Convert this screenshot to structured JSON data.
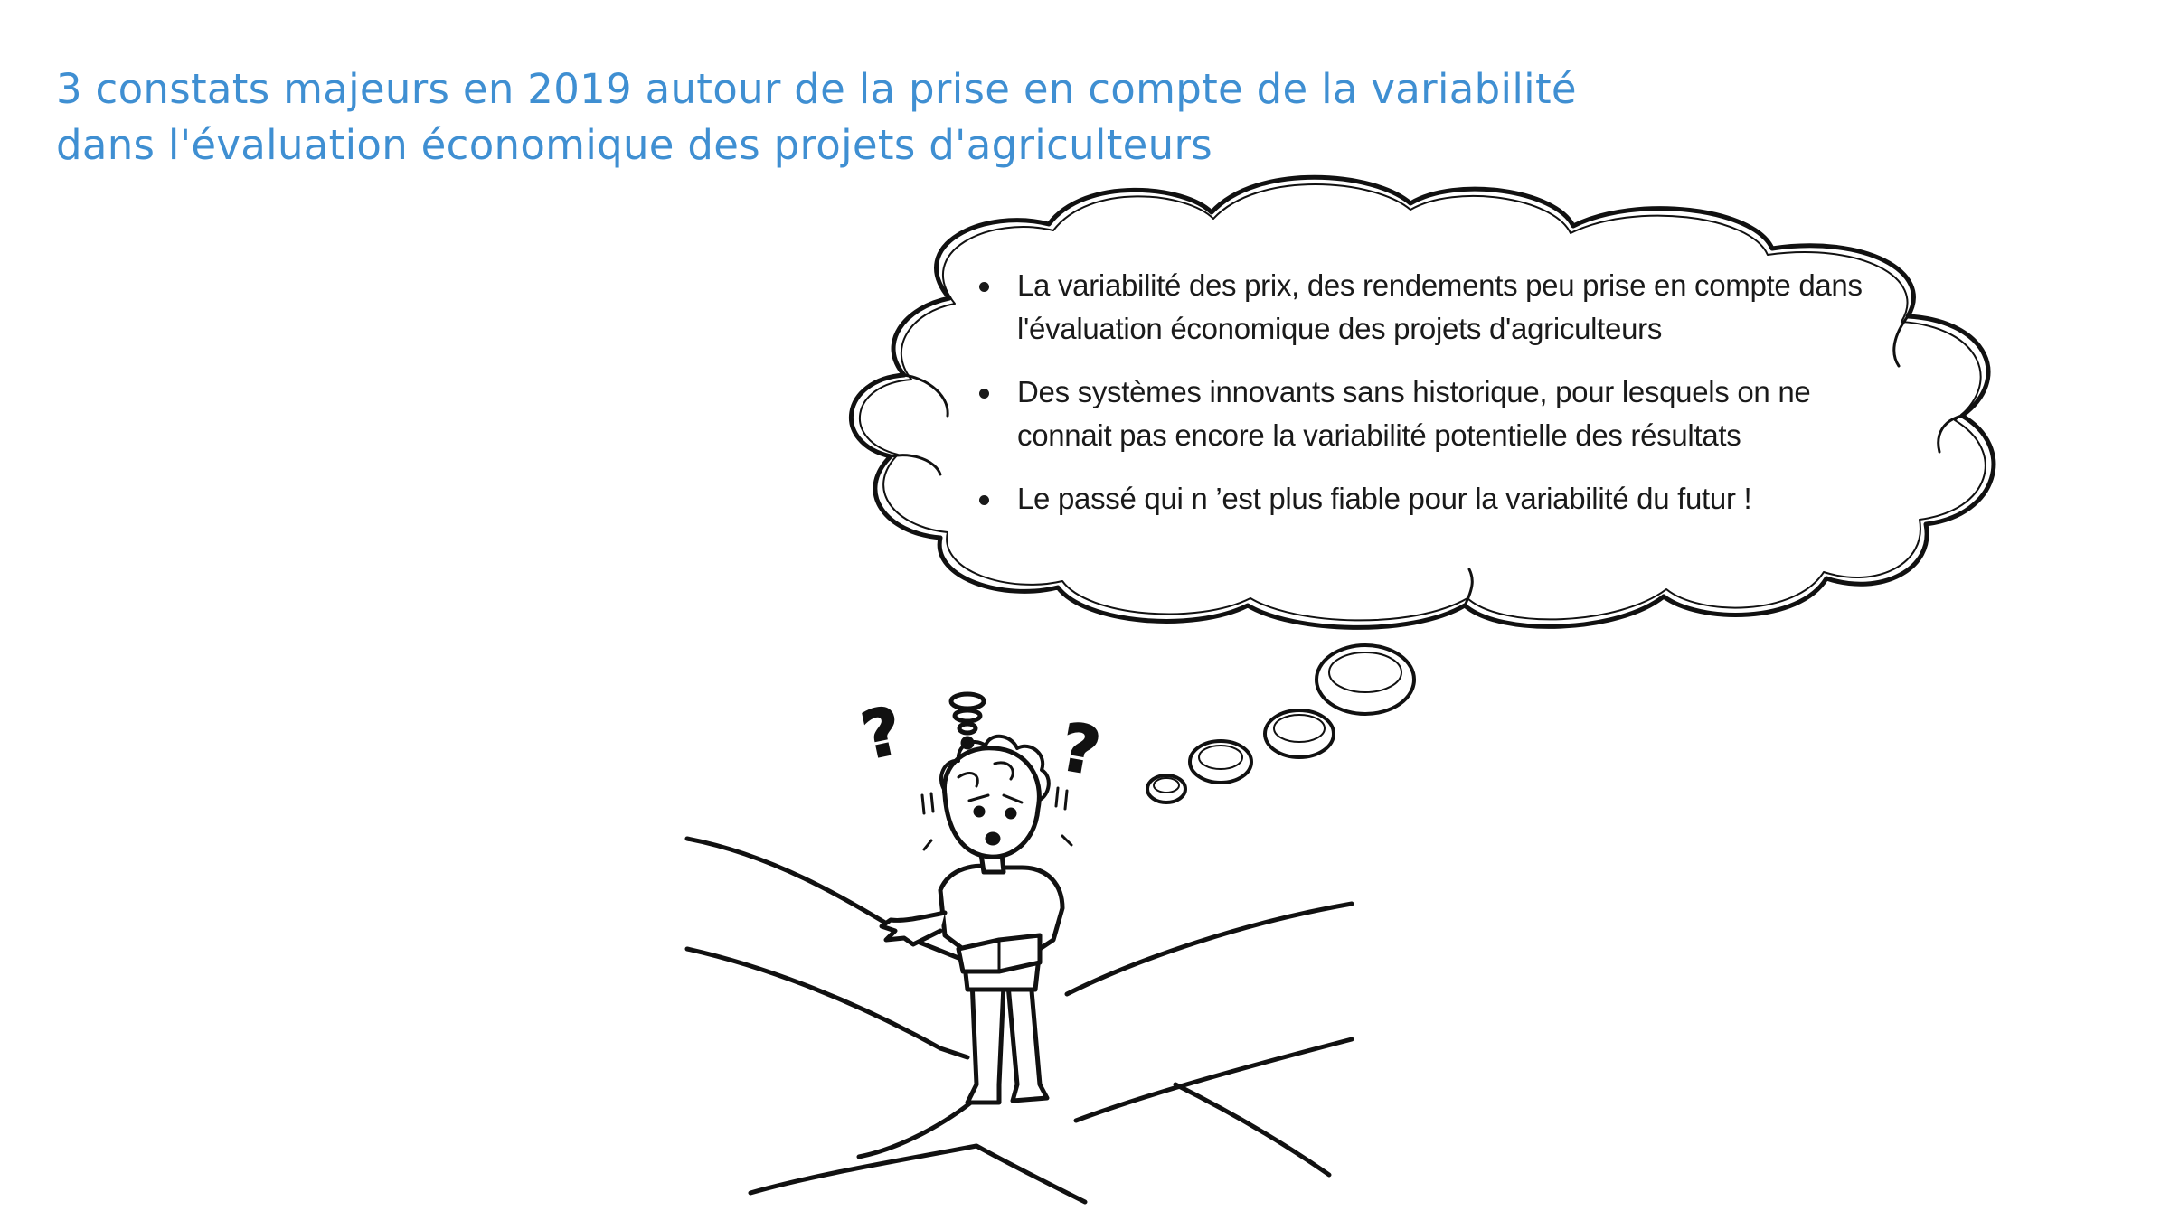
{
  "title": {
    "line1": "3 constats majeurs en 2019 autour de la prise en compte de la variabilité",
    "line2": "dans l'évaluation économique des projets d'agriculteurs"
  },
  "bubble": {
    "items": [
      {
        "text": "La variabilité  des prix, des rendements peu prise en compte dans l'évaluation économique des projets d'agriculteurs"
      },
      {
        "text": "Des systèmes innovants sans historique, pour lesquels on ne connait pas encore la variabilité potentielle des résultats"
      },
      {
        "text": "Le passé qui n ’est plus fiable pour la variabilité du futur !"
      }
    ]
  },
  "colors": {
    "title": "#3f8fd2",
    "ink": "#111111"
  },
  "illustration": {
    "subject": "confused-person-at-crossroads",
    "marks": [
      "?",
      "?",
      "?"
    ]
  }
}
